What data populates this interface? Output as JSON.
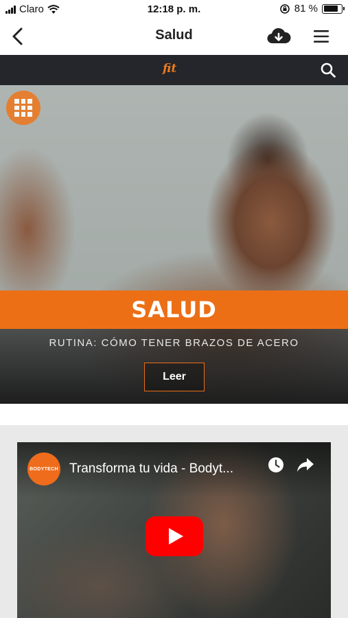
{
  "status_bar": {
    "carrier": "Claro",
    "time": "12:18 p. m.",
    "battery_text": "81 %",
    "battery_level": 0.81,
    "icons": [
      "signal-icon",
      "wifi-icon",
      "rotation-lock-icon",
      "battery-icon"
    ]
  },
  "header": {
    "title": "Salud",
    "icons": [
      "back-arrow-icon",
      "cloud-download-icon",
      "hamburger-menu-icon"
    ]
  },
  "brand_bar": {
    "logo_text": "fit",
    "icons": [
      "search-icon"
    ],
    "background": "#24262b",
    "accent": "#f07a1e"
  },
  "hero": {
    "category": "SALUD",
    "subtitle": "RUTINA: CÓMO TENER BRAZOS DE ACERO",
    "read_label": "Leer",
    "icons": [
      "grid-icon"
    ],
    "banner_color": "#ec6f16"
  },
  "video": {
    "channel_name": "BODYTECH",
    "title": "Transforma tu vida - Bodyt...",
    "icons": [
      "watch-later-icon",
      "share-icon",
      "youtube-play-icon"
    ],
    "play_color": "#ff0000"
  }
}
